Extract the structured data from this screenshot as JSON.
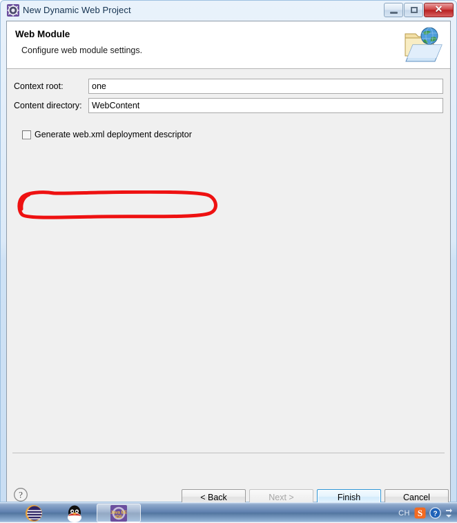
{
  "window": {
    "title": "New Dynamic Web Project",
    "icon": "eclipse-gear-icon",
    "controls": {
      "minimize": "minimize-icon",
      "maximize": "maximize-icon",
      "close": "✕"
    }
  },
  "wizard": {
    "heading": "Web Module",
    "subheading": "Configure web module settings.",
    "banner_icon": "web-folder-globe-icon"
  },
  "form": {
    "context_root": {
      "label": "Context root:",
      "value": "one"
    },
    "content_directory": {
      "label": "Content directory:",
      "value": "WebContent"
    },
    "generate_webxml": {
      "label": "Generate web.xml deployment descriptor",
      "checked": false
    }
  },
  "annotation": {
    "type": "hand-drawn-red-ellipse",
    "color": "#ee1111",
    "target": "generate-webxml-checkbox"
  },
  "footer": {
    "help_label": "?",
    "buttons": [
      {
        "label": "< Back",
        "name": "back-button",
        "state": "enabled"
      },
      {
        "label": "Next >",
        "name": "next-button",
        "state": "disabled"
      },
      {
        "label": "Finish",
        "name": "finish-button",
        "state": "default"
      },
      {
        "label": "Cancel",
        "name": "cancel-button",
        "state": "enabled"
      }
    ]
  },
  "taskbar": {
    "items": [
      {
        "name": "taskbar-orb-icon",
        "label": ""
      },
      {
        "name": "taskbar-qq-icon",
        "label": ""
      },
      {
        "name": "taskbar-eclipse-javaee-ide",
        "label": "Java EE IDE"
      }
    ],
    "tray": {
      "ime": "CH",
      "sogou": "S",
      "help": "?",
      "expand": "show-hidden-icons"
    }
  },
  "colors": {
    "title_bar": "#dceaf8",
    "client_bg": "#f0f0f0",
    "header_bg": "#ffffff",
    "accent_blue": "#2c95d6",
    "annotation_red": "#ee1111",
    "taskbar_blue": "#5d7fae"
  }
}
